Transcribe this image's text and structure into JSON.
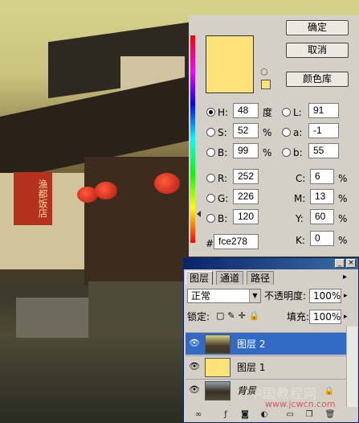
{
  "picker": {
    "buttons": {
      "ok": "确定",
      "cancel": "取消",
      "libraries": "颜色库"
    },
    "current_color": "#fce278",
    "hsb": [
      {
        "label": "H:",
        "value": "48",
        "unit": "度",
        "selected": true
      },
      {
        "label": "S:",
        "value": "52",
        "unit": "%",
        "selected": false
      },
      {
        "label": "B:",
        "value": "99",
        "unit": "%",
        "selected": false
      }
    ],
    "lab": [
      {
        "label": "L:",
        "value": "91"
      },
      {
        "label": "a:",
        "value": "-1"
      },
      {
        "label": "b:",
        "value": "55"
      }
    ],
    "rgb": [
      {
        "label": "R:",
        "value": "252"
      },
      {
        "label": "G:",
        "value": "226"
      },
      {
        "label": "B:",
        "value": "120"
      }
    ],
    "cmyk": [
      {
        "label": "C:",
        "value": "6",
        "unit": "%"
      },
      {
        "label": "M:",
        "value": "13",
        "unit": "%"
      },
      {
        "label": "Y:",
        "value": "60",
        "unit": "%"
      },
      {
        "label": "K:",
        "value": "0",
        "unit": "%"
      }
    ],
    "hex_label": "#",
    "hex_value": "fce278"
  },
  "layers_panel": {
    "tabs": [
      "图层",
      "通道",
      "路径"
    ],
    "blend_mode": "正常",
    "opacity_label": "不透明度:",
    "opacity_value": "100%",
    "lock_label": "锁定:",
    "fill_label": "填充:",
    "fill_value": "100%",
    "layers": [
      {
        "name": "图层 2",
        "active": true
      },
      {
        "name": "图层 1",
        "active": false
      },
      {
        "name": "背景",
        "active": false
      }
    ]
  },
  "photo": {
    "sign_text": "渔都饭店"
  },
  "watermark": {
    "text": "中国教程网",
    "url": "www.jcwcn.com"
  }
}
